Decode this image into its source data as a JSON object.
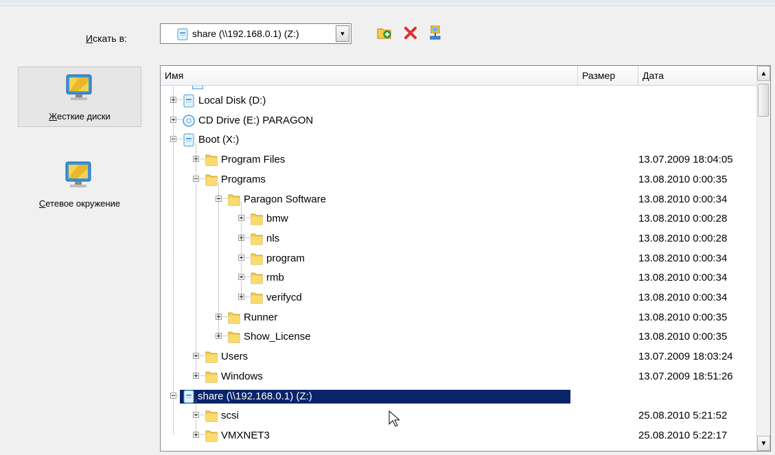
{
  "lookin": {
    "label": "Искать в:",
    "accesskey": "И",
    "rest": "скать в:",
    "value": "share (\\\\192.168.0.1) (Z:)"
  },
  "toolbar": {
    "new_folder_icon": "new-folder-icon",
    "delete_icon": "delete-icon",
    "network_drive_icon": "map-network-drive-icon"
  },
  "places": [
    {
      "label": "Жесткие диски",
      "accesskey": "Ж",
      "rest": "есткие диски",
      "icon": "monitor-icon"
    },
    {
      "label": "Сетевое окружение",
      "accesskey": "С",
      "rest": "етевое окружение",
      "icon": "monitor-icon"
    }
  ],
  "columns": {
    "name": "Имя",
    "size": "Размер",
    "date": "Дата"
  },
  "rows": [
    {
      "name": "Local Disk (D:)",
      "date": "",
      "type": "disk",
      "level": 0,
      "state": "plus"
    },
    {
      "name": "CD Drive (E:) PARAGON",
      "date": "",
      "type": "cd",
      "level": 0,
      "state": "plus"
    },
    {
      "name": "Boot (X:)",
      "date": "",
      "type": "disk",
      "level": 0,
      "state": "minus"
    },
    {
      "name": "Program Files",
      "date": "13.07.2009 18:04:05",
      "type": "folder",
      "level": 1,
      "state": "plus"
    },
    {
      "name": "Programs",
      "date": "13.08.2010 0:00:35",
      "type": "folder",
      "level": 1,
      "state": "minus"
    },
    {
      "name": "Paragon Software",
      "date": "13.08.2010 0:00:34",
      "type": "folder",
      "level": 2,
      "state": "minus"
    },
    {
      "name": "bmw",
      "date": "13.08.2010 0:00:28",
      "type": "folder",
      "level": 3,
      "state": "plus"
    },
    {
      "name": "nls",
      "date": "13.08.2010 0:00:28",
      "type": "folder",
      "level": 3,
      "state": "plus"
    },
    {
      "name": "program",
      "date": "13.08.2010 0:00:34",
      "type": "folder",
      "level": 3,
      "state": "plus"
    },
    {
      "name": "rmb",
      "date": "13.08.2010 0:00:34",
      "type": "folder",
      "level": 3,
      "state": "plus"
    },
    {
      "name": "verifycd",
      "date": "13.08.2010 0:00:34",
      "type": "folder",
      "level": 3,
      "state": "plus"
    },
    {
      "name": "Runner",
      "date": "13.08.2010 0:00:35",
      "type": "folder",
      "level": 2,
      "state": "plus"
    },
    {
      "name": "Show_License",
      "date": "13.08.2010 0:00:35",
      "type": "folder",
      "level": 2,
      "state": "plus"
    },
    {
      "name": "Users",
      "date": "13.07.2009 18:03:24",
      "type": "folder",
      "level": 1,
      "state": "plus"
    },
    {
      "name": "Windows",
      "date": "13.07.2009 18:51:26",
      "type": "folder",
      "level": 1,
      "state": "plus"
    },
    {
      "name": "share (\\\\192.168.0.1) (Z:)",
      "date": "",
      "type": "netdisk",
      "level": 0,
      "state": "minus",
      "selected": true
    },
    {
      "name": "scsi",
      "date": "25.08.2010 5:21:52",
      "type": "folder",
      "level": 1,
      "state": "plus"
    },
    {
      "name": "VMXNET3",
      "date": "25.08.2010 5:22:17",
      "type": "folder",
      "level": 1,
      "state": "plus"
    }
  ]
}
